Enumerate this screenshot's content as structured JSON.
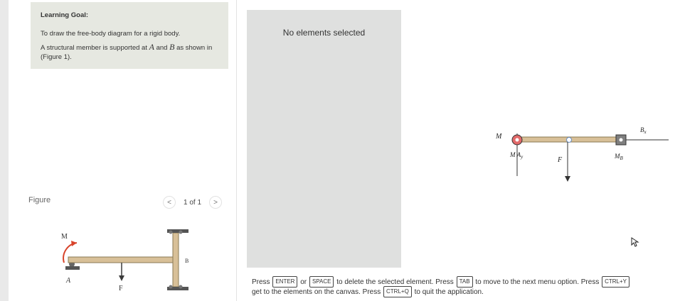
{
  "goal": {
    "title": "Learning Goal:",
    "line1": "To draw the free-body diagram for a rigid body.",
    "line2_a": "A structural member is supported at",
    "var_a": "A",
    "line2_and": "and",
    "var_b": "B",
    "line2_b": "as shown in (Figure 1)."
  },
  "figure": {
    "label": "Figure",
    "pager_prev": "<",
    "pager_text": "1 of 1",
    "pager_next": ">",
    "label_M": "M",
    "label_A": "A",
    "label_F": "F",
    "label_B": "B"
  },
  "palette": {
    "status": "No elements selected"
  },
  "canvas": {
    "label_M": "M",
    "label_Ay": "M A",
    "label_Ay_sub": "y",
    "label_F": "F",
    "label_MB": "M",
    "label_MB_sub": "B",
    "label_Bx": "B",
    "label_Bx_sub": "x"
  },
  "instructions": {
    "line1": {
      "t1": "Press",
      "k1": "ENTER",
      "t2": "or",
      "k2": "SPACE",
      "t3": "to delete the selected element. Press",
      "k3": "TAB",
      "t4": "to move to the next menu option. Press",
      "k4": "CTRL+Y"
    },
    "line2": {
      "t1": "get to the elements on the canvas. Press",
      "k1": "CTRL+Q",
      "t2": "to quit the application."
    }
  },
  "colors": {
    "beam": "#d8c098",
    "beam_edge": "#8a7a55",
    "moment_arrow": "#d8442b",
    "support": "#555555",
    "selected_support": "#e26a6a",
    "load_arrow": "#3a3a3a"
  }
}
